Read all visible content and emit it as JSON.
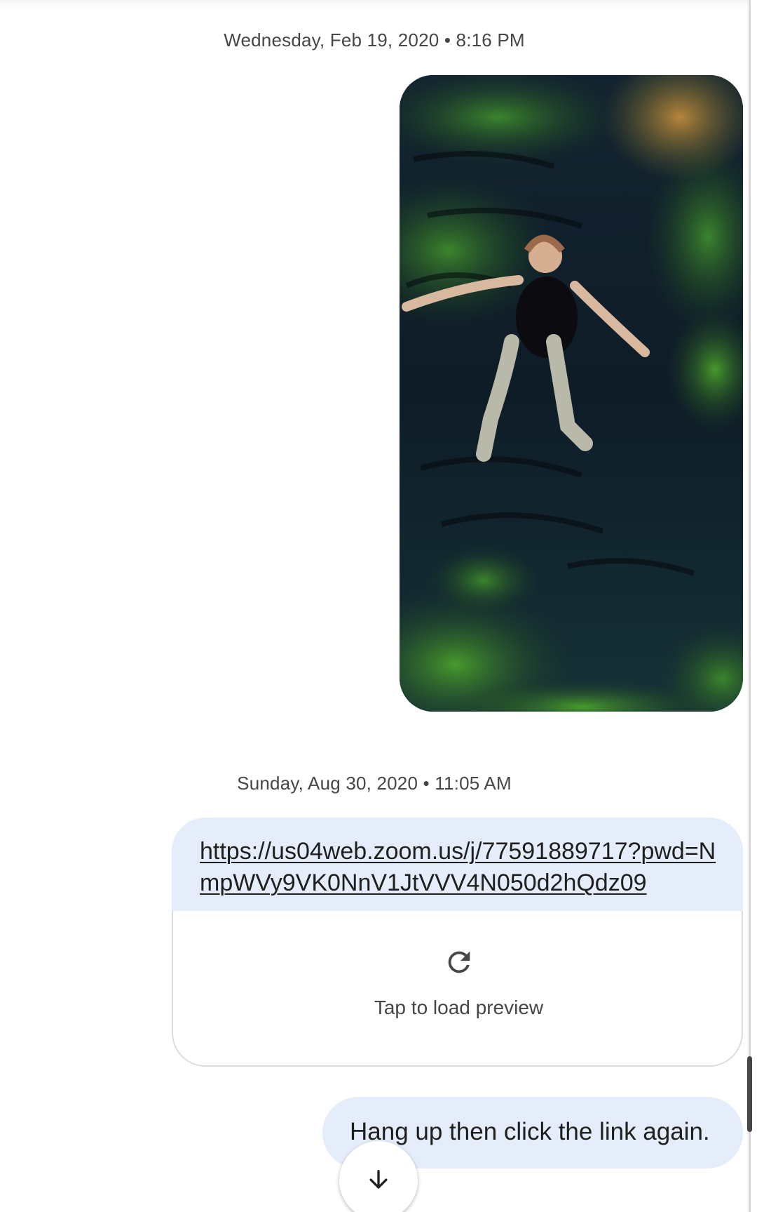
{
  "conversation": {
    "messages": [
      {
        "timestamp": "Wednesday, Feb 19, 2020 • 8:16 PM",
        "type": "image",
        "image_description": "person floating in clear water"
      },
      {
        "timestamp": "Sunday, Aug 30, 2020 • 11:05 AM",
        "type": "link",
        "link_text": "https://us04web.zoom.us/j/77591889717?pwd=NmpWVy9VK0NnV1JtVVV4N050d2hQdz09",
        "preview_label": "Tap to load preview",
        "preview_icon": "refresh-icon"
      },
      {
        "type": "text",
        "text": "Hang up then click the link again."
      }
    ]
  },
  "controls": {
    "scroll_down_icon": "arrow-down-icon"
  },
  "colors": {
    "outgoing_bubble": "#e5edfa",
    "text_primary": "#1f1f1f",
    "text_secondary": "#444746",
    "border": "#d9dce0"
  }
}
